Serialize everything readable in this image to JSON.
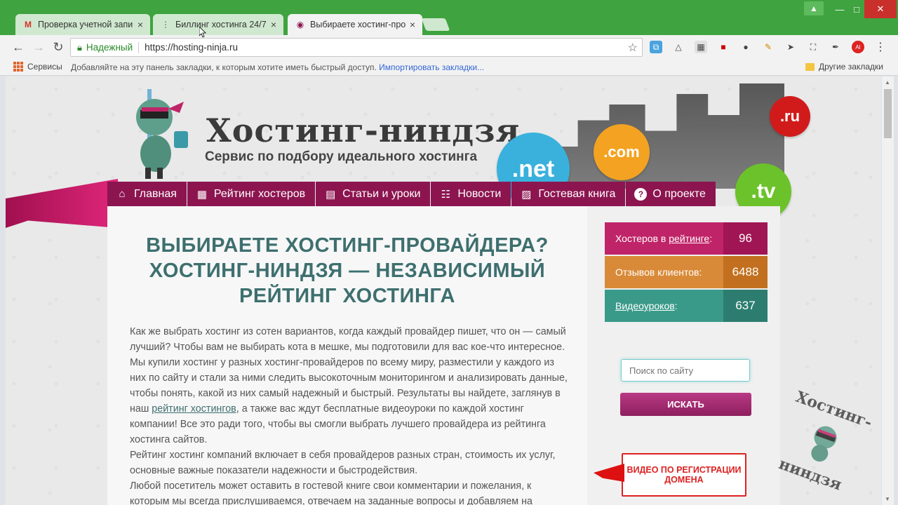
{
  "browser": {
    "tabs": [
      {
        "title": "Проверка учетной запи",
        "favicon": "gmail-icon",
        "active": false
      },
      {
        "title": "Биллинг хостинга 24/7",
        "favicon": "dots-icon",
        "active": false
      },
      {
        "title": "Выбираете хостинг-про",
        "favicon": "ninja-icon",
        "active": true
      }
    ],
    "address": {
      "secure_label": "Надежный",
      "url": "https://hosting-ninja.ru"
    },
    "bookmarks": {
      "apps_label": "Сервисы",
      "hint": "Добавляйте на эту панель закладки, к которым хотите иметь быстрый доступ.",
      "import_label": "Импортировать закладки...",
      "other_label": "Другие закладки"
    }
  },
  "site": {
    "logo_title": "Хостинг-ниндзя",
    "logo_subtitle": "Сервис по подбору идеального хостинга",
    "domains": [
      ".net",
      ".com",
      ".ru",
      ".tv"
    ],
    "nav": [
      {
        "label": "Главная",
        "icon": "home-icon"
      },
      {
        "label": "Рейтинг хостеров",
        "icon": "rating-icon"
      },
      {
        "label": "Статьи и уроки",
        "icon": "articles-icon"
      },
      {
        "label": "Новости",
        "icon": "news-icon"
      },
      {
        "label": "Гостевая книга",
        "icon": "guestbook-icon"
      },
      {
        "label": "О проекте",
        "icon": "question-icon"
      }
    ],
    "headline": "ВЫБИРАЕТЕ ХОСТИНГ-ПРОВАЙДЕРА? ХОСТИНГ-НИНДЗЯ — НЕЗАВИСИМЫЙ РЕЙТИНГ ХОСТИНГА",
    "paragraph1_a": "Как же выбрать хостинг из сотен вариантов, когда каждый провайдер пишет, что он — самый лучший? Чтобы вам не выбирать кота в мешке, мы подготовили для вас кое-что интересное. Мы купили хостинг у разных хостинг-провайдеров по всему миру, разместили у каждого из них по сайту и стали за ними следить высокоточным мониторингом и анализировать данные, чтобы понять, какой из них самый надежный и быстрый. Результаты вы найдете, заглянув в наш ",
    "paragraph1_link": "рейтинг хостингов",
    "paragraph1_b": ", а также вас ждут бесплатные видеоуроки по каждой хостинг компании! Все это ради того, чтобы вы смогли выбрать лучшего провайдера из рейтинга хостинга сайтов.",
    "paragraph2": "Рейтинг хостинг компаний включает в себя провайдеров разных стран, стоимость их услуг, основные важные показатели надежности и быстродействия.",
    "paragraph3": "Любой посетитель может оставить в гостевой книге свои комментарии и пожелания, к которым мы всегда прислушиваемся, отвечаем на заданные вопросы и добавляем на",
    "stats": [
      {
        "label_prefix": "Хостеров в ",
        "label_link": "рейтинге",
        "label_suffix": ":",
        "value": "96",
        "color": "#c02468"
      },
      {
        "label_prefix": "Отзывов клиентов:",
        "label_link": "",
        "label_suffix": "",
        "value": "6488",
        "color": "#d98a38"
      },
      {
        "label_prefix": "",
        "label_link": "Видеоуроков",
        "label_suffix": ":",
        "value": "637",
        "color": "#3a9a8a"
      }
    ],
    "search_placeholder": "Поиск по сайту",
    "search_button": "ИСКАТЬ",
    "video_box": "ВИДЕО ПО РЕГИСТРАЦИИ ДОМЕНА",
    "stamp_lines": [
      "Хостинг-",
      "ниндзя"
    ]
  }
}
